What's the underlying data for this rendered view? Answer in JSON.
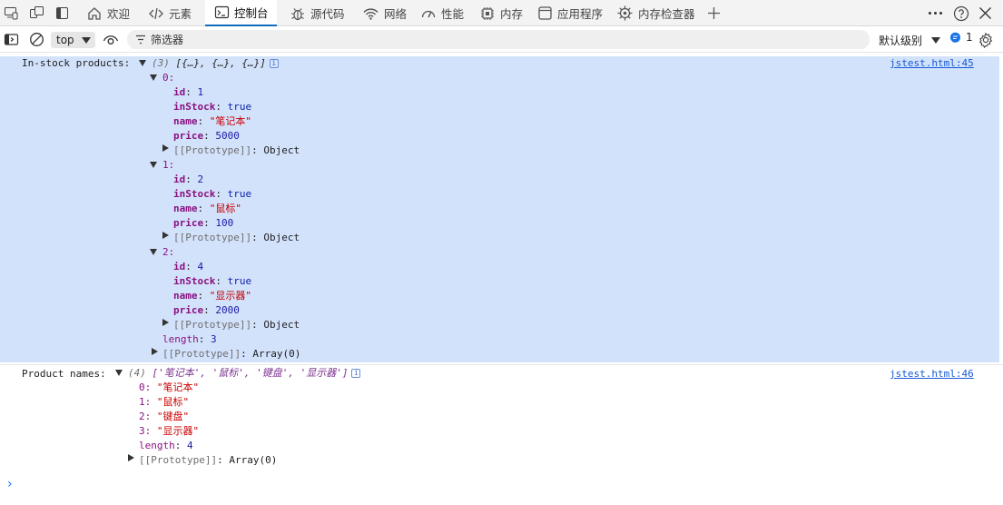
{
  "tabs": [
    {
      "label": "欢迎"
    },
    {
      "label": "元素"
    },
    {
      "label": "控制台"
    },
    {
      "label": "源代码"
    },
    {
      "label": "网络"
    },
    {
      "label": "性能"
    },
    {
      "label": "内存"
    },
    {
      "label": "应用程序"
    },
    {
      "label": "内存检查器"
    }
  ],
  "toolbar": {
    "context": "top",
    "filter_placeholder": "筛选器",
    "level": "默认级别",
    "issue_count": "1"
  },
  "messages": [
    {
      "label": "In-stock products:",
      "preview_count": "(3)",
      "preview": "[{…}, {…}, {…}]",
      "source": "jstest.html:45",
      "items": [
        {
          "index": "0:",
          "id": "1",
          "inStock": "true",
          "name": "\"笔记本\"",
          "price": "5000"
        },
        {
          "index": "1:",
          "id": "2",
          "inStock": "true",
          "name": "\"鼠标\"",
          "price": "100"
        },
        {
          "index": "2:",
          "id": "4",
          "inStock": "true",
          "name": "\"显示器\"",
          "price": "2000"
        }
      ],
      "keys": {
        "id": "id",
        "inStock": "inStock",
        "name": "name",
        "price": "price"
      },
      "item_proto_key": "[[Prototype]]",
      "item_proto_val": "Object",
      "length_key": "length",
      "length_val": "3",
      "array_proto_key": "[[Prototype]]",
      "array_proto_val": "Array(0)"
    },
    {
      "label": "Product names:",
      "preview_count": "(4)",
      "preview": "['笔记本', '鼠标', '键盘', '显示器']",
      "source": "jstest.html:46",
      "items": [
        {
          "index": "0:",
          "value": "\"笔记本\""
        },
        {
          "index": "1:",
          "value": "\"鼠标\""
        },
        {
          "index": "2:",
          "value": "\"键盘\""
        },
        {
          "index": "3:",
          "value": "\"显示器\""
        }
      ],
      "length_key": "length",
      "length_val": "4",
      "array_proto_key": "[[Prototype]]",
      "array_proto_val": "Array(0)"
    }
  ],
  "prompt_symbol": "›",
  "info_glyph": "i",
  "colors": {
    "accent": "#0f6cbd",
    "selected_row": "#d3e2fb",
    "key": "#881280",
    "string": "#c80000",
    "number": "#1a1aa6",
    "link": "#1558d6"
  },
  "icons": [
    "device-emulation-icon",
    "dock-icon",
    "sidebar-icon",
    "home-icon",
    "code-icon",
    "console-icon",
    "bug-icon",
    "wifi-icon",
    "performance-icon",
    "memory-chip-icon",
    "application-icon",
    "memory-inspector-icon",
    "plus-icon",
    "more-icon",
    "help-icon",
    "close-icon",
    "show-sidebar-icon",
    "clear-icon",
    "eye-icon",
    "filter-icon",
    "message-icon",
    "gear-icon"
  ]
}
